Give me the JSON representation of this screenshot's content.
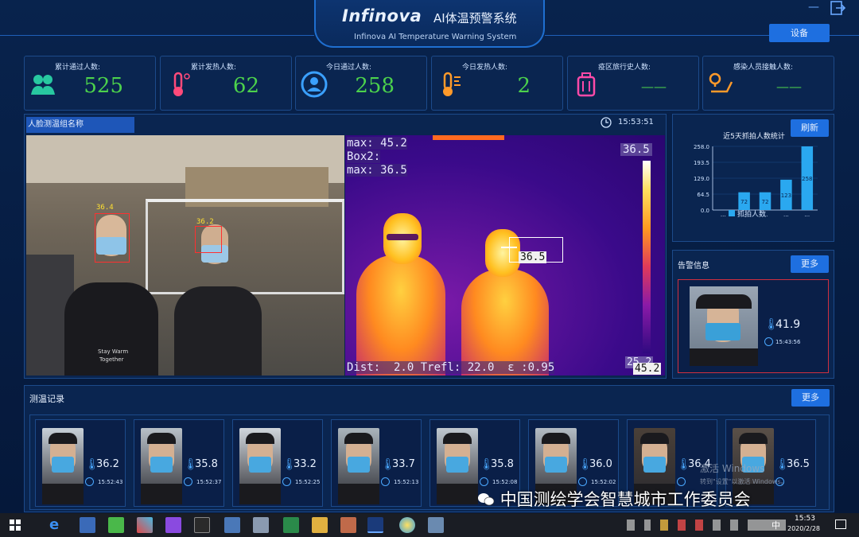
{
  "header": {
    "brand": "Infinova",
    "title": "AI体温预警系统",
    "subtitle": "Infinova AI Temperature Warning System",
    "settings_label": "设备"
  },
  "stats": [
    {
      "label": "累计通过人数:",
      "value": "525",
      "icon": "people-icon",
      "color": "#28c8a0"
    },
    {
      "label": "累计发热人数:",
      "value": "62",
      "icon": "thermometer-icon",
      "color": "#ff4a7a"
    },
    {
      "label": "今日通过人数:",
      "value": "258",
      "icon": "user-circle-icon",
      "color": "#3aa0ff"
    },
    {
      "label": "今日发热人数:",
      "value": "2",
      "icon": "thermometer-icon",
      "color": "#ff9a2a"
    },
    {
      "label": "疫区旅行史人数:",
      "value": "——",
      "icon": "luggage-icon",
      "color": "#ff4aa8"
    },
    {
      "label": "感染人员接触人数:",
      "value": "——",
      "icon": "location-route-icon",
      "color": "#ff9a2a"
    }
  ],
  "video": {
    "group_title": "人脸测温组名称",
    "clock": "15:53:51",
    "face_labels": [
      "36.4",
      "36.2"
    ],
    "shirt_text": [
      "Stay Warm",
      "Together"
    ],
    "thermal": {
      "line1": "max: 45.2",
      "line2": "Box2:",
      "line3": "max: 36.5",
      "scale_top": "36.5",
      "scale_bottom": "25.2",
      "scale_bottom2": "45.2",
      "box_value": "36.5",
      "footer": "Dist:  2.0 Trefl: 22.0  ε :0.95"
    }
  },
  "chart_panel": {
    "refresh_label": "刷新",
    "chart_data": {
      "type": "bar",
      "title": "近5天抓拍人数统计",
      "categories": [
        "",
        "",
        "",
        "",
        ""
      ],
      "series": [
        {
          "name": "抓拍人数",
          "values": [
            0,
            72,
            72,
            123,
            258
          ]
        }
      ],
      "data_labels": [
        "",
        "72",
        "72",
        "123",
        "258"
      ],
      "yticks": [
        "258.0",
        "193.5",
        "129.0",
        "64.5",
        "0.0"
      ],
      "ylim": [
        0,
        258
      ],
      "color": "#2aa8f0"
    }
  },
  "alarm": {
    "title": "告警信息",
    "more_label": "更多",
    "temp": "41.9",
    "time": "15:43:56"
  },
  "records": {
    "title": "测温记录",
    "more_label": "更多",
    "items": [
      {
        "temp": "36.2",
        "time": "15:52:43"
      },
      {
        "temp": "35.8",
        "time": "15:52:37"
      },
      {
        "temp": "33.2",
        "time": "15:52:25"
      },
      {
        "temp": "33.7",
        "time": "15:52:13"
      },
      {
        "temp": "35.8",
        "time": "15:52:08"
      },
      {
        "temp": "36.0",
        "time": "15:52:02"
      },
      {
        "temp": "36.4",
        "time": ""
      },
      {
        "temp": "36.5",
        "time": ""
      }
    ]
  },
  "overlay": {
    "activate": "激活 Windows",
    "activate_sub": "转到\"设置\"以激活 Windows。",
    "wechat": "中国测绘学会智慧城市工作委员会"
  },
  "taskbar": {
    "ime": "中",
    "time": "15:53",
    "date": "2020/2/28"
  }
}
